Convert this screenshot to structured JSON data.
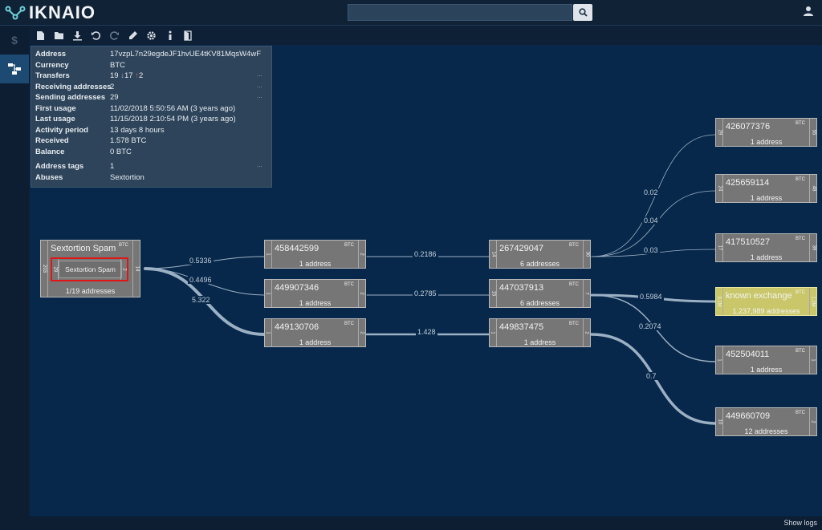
{
  "app": {
    "brand": "IKNAIO"
  },
  "search": {
    "placeholder": ""
  },
  "footer": {
    "show_logs": "Show logs"
  },
  "info": {
    "rows": [
      {
        "label": "Address",
        "value": "17vzpL7n29egdeJF1hvUE4tKV81MqsW4wF"
      },
      {
        "label": "Currency",
        "value": "BTC"
      },
      {
        "label": "Transfers",
        "value": "19",
        "down": "17",
        "up": "2",
        "down_glyph": "↓",
        "up_glyph": "↑"
      },
      {
        "label": "Receiving addresses",
        "value": "2"
      },
      {
        "label": "Sending addresses",
        "value": "29"
      },
      {
        "label": "First usage",
        "value": "11/02/2018 5:50:56 AM (3 years ago)"
      },
      {
        "label": "Last usage",
        "value": "11/15/2018 2:10:54 PM (3 years ago)"
      },
      {
        "label": "Activity period",
        "value": "13 days 8 hours"
      },
      {
        "label": "Received",
        "value": "1.578 BTC"
      },
      {
        "label": "Balance",
        "value": "0 BTC"
      },
      {
        "label": "Address tags",
        "value": "1"
      },
      {
        "label": "Abuses",
        "value": "Sextortion"
      }
    ],
    "more": "···"
  },
  "entity": {
    "title": "Sextortion Spam",
    "currency": "BTC",
    "in_port": "203",
    "out_port": "14",
    "sub": "1/19 addresses",
    "tag": {
      "label": "Sextortion Spam",
      "in_port": "29",
      "out_port": "2"
    }
  },
  "nodes": [
    {
      "id": "458442599",
      "title": "458442599",
      "sub": "1 address",
      "currency": "BTC",
      "in": "1",
      "out": "2"
    },
    {
      "id": "449907346",
      "title": "449907346",
      "sub": "1 address",
      "currency": "BTC",
      "in": "1",
      "out": "2"
    },
    {
      "id": "449130706",
      "title": "449130706",
      "sub": "1 address",
      "currency": "BTC",
      "in": "1",
      "out": "2"
    },
    {
      "id": "267429047",
      "title": "267429047",
      "sub": "6 addresses",
      "currency": "BTC",
      "in": "14",
      "out": "30"
    },
    {
      "id": "447037913",
      "title": "447037913",
      "sub": "6 addresses",
      "currency": "BTC",
      "in": "15",
      "out": "7"
    },
    {
      "id": "449837475",
      "title": "449837475",
      "sub": "1 address",
      "currency": "BTC",
      "in": "1",
      "out": "2"
    },
    {
      "id": "426077376",
      "title": "426077376",
      "sub": "1 address",
      "currency": "BTC",
      "in": "29",
      "out": "55"
    },
    {
      "id": "425659114",
      "title": "425659114",
      "sub": "1 address",
      "currency": "BTC",
      "in": "24",
      "out": "48"
    },
    {
      "id": "417510527",
      "title": "417510527",
      "sub": "1 address",
      "currency": "BTC",
      "in": "17",
      "out": "39"
    },
    {
      "id": "known",
      "title": "known exchange",
      "sub": "1,237,989 addresses",
      "currency": "BTC",
      "in": "3.1M",
      "out": "1.2M"
    },
    {
      "id": "452504011",
      "title": "452504011",
      "sub": "1 address",
      "currency": "BTC",
      "in": "1",
      "out": "1"
    },
    {
      "id": "449660709",
      "title": "449660709",
      "sub": "12 addresses",
      "currency": "BTC",
      "in": "10",
      "out": "2"
    }
  ],
  "edges": [
    {
      "label": "0.5336"
    },
    {
      "label": "0.4496"
    },
    {
      "label": "5.322"
    },
    {
      "label": "0.2186"
    },
    {
      "label": "0.2785"
    },
    {
      "label": "1.428"
    },
    {
      "label": "0.02"
    },
    {
      "label": "0.04"
    },
    {
      "label": "0.03"
    },
    {
      "label": "0.5984"
    },
    {
      "label": "0.2074"
    },
    {
      "label": "0.7"
    }
  ],
  "colors": {
    "canvas": "#07284b",
    "node": "#767676",
    "known": "#c9c76a",
    "edge": "#9cb0c4",
    "tag_border": "#e01616"
  },
  "icons": {
    "toolbar": [
      "new-file-icon",
      "open-folder-icon",
      "download-icon",
      "undo-icon",
      "redo-icon",
      "highlight-pen-icon",
      "settings-gear-icon",
      "info-icon",
      "exit-door-icon"
    ],
    "sidebar": [
      "currency-icon",
      "graph-icon"
    ]
  }
}
